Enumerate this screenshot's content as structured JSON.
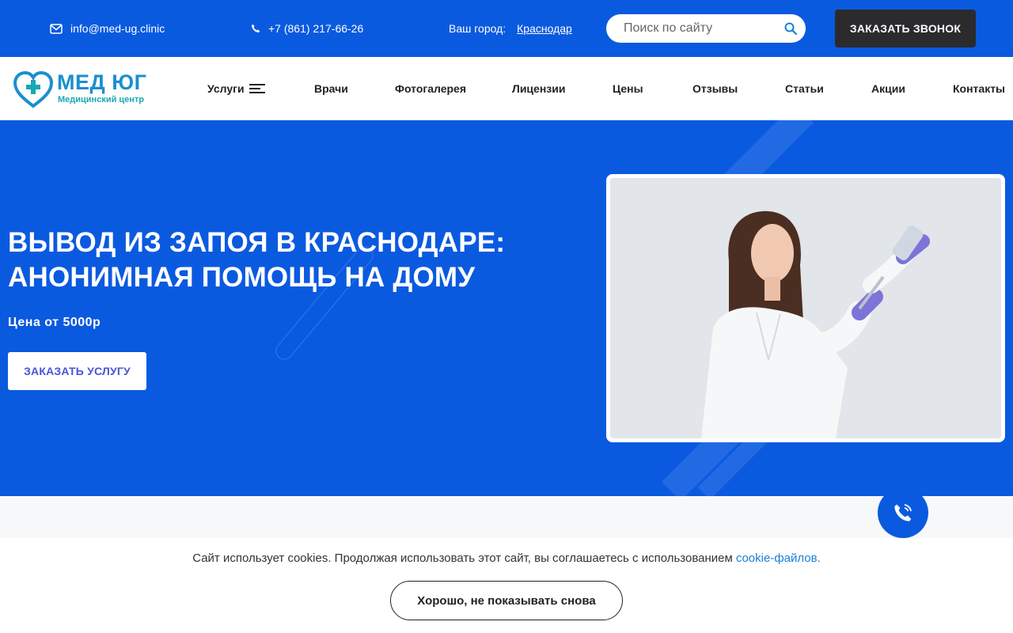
{
  "topbar": {
    "email": "info@med-ug.clinic",
    "phone": "+7 (861) 217-66-26",
    "city_label": "Ваш город:",
    "city": "Краснодар",
    "search_placeholder": "Поиск по сайту",
    "call_button": "ЗАКАЗАТЬ ЗВОНОК"
  },
  "logo": {
    "brand": "МЕД ЮГ",
    "subtitle": "Медицинский центр"
  },
  "nav": {
    "items": [
      "Услуги",
      "Врачи",
      "Фотогалерея",
      "Лицензии",
      "Цены",
      "Отзывы",
      "Статьи",
      "Акции",
      "Контакты"
    ]
  },
  "hero": {
    "title": "ВЫВОД ИЗ ЗАПОЯ В КРАСНОДАРЕ: АНОНИМНАЯ ПОМОЩЬ НА ДОМУ",
    "price": "Цена от 5000р",
    "order_button": "ЗАКАЗАТЬ УСЛУГУ"
  },
  "cookie": {
    "text": "Сайт использует cookies. Продолжая использовать этот сайт, вы соглашаетесь с использованием",
    "link": "cookie-файлов.",
    "button": "Хорошо, не показывать снова"
  },
  "colors": {
    "primary": "#0a5ae0",
    "dark_button": "#2b2b2e",
    "logo_blue": "#1a8fcf",
    "logo_teal": "#1aa7b5",
    "link": "#1a7fd6"
  },
  "icons": [
    "envelope-icon",
    "phone-icon",
    "search-icon",
    "menu-lines-icon",
    "phone-call-icon"
  ]
}
